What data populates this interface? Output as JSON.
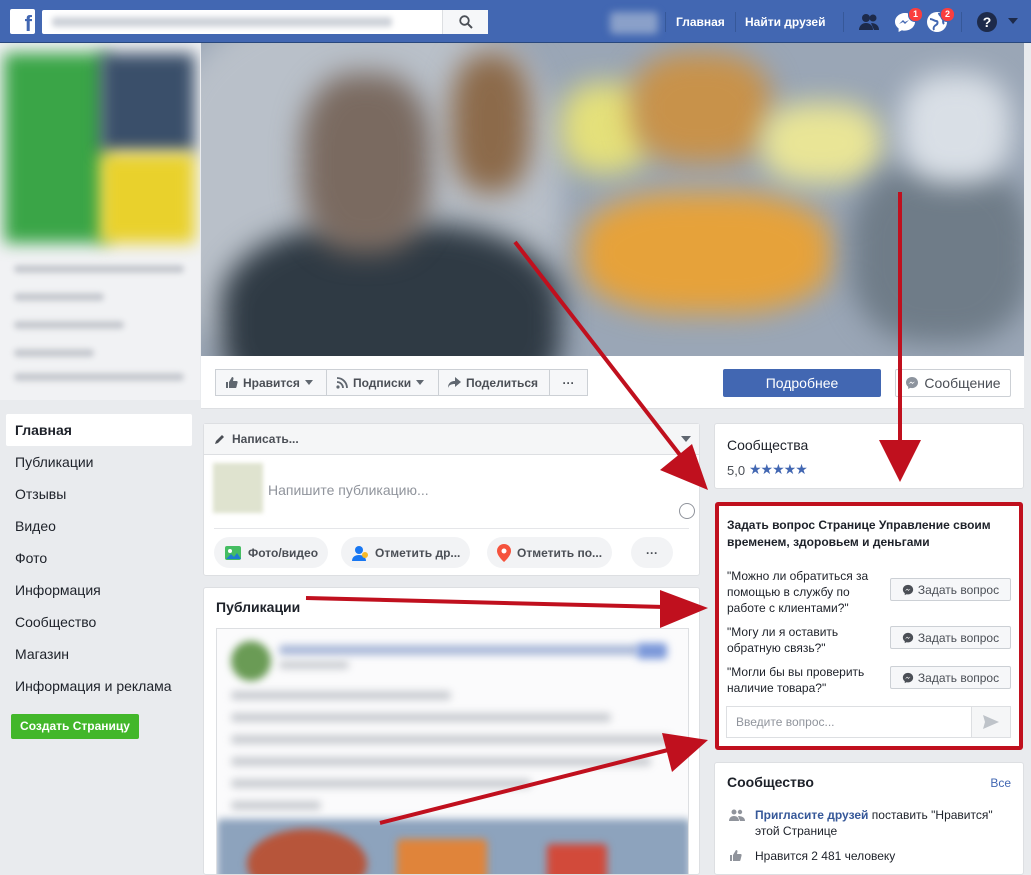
{
  "topbar": {
    "logo": "f",
    "search_placeholder": "",
    "nav_home": "Главная",
    "nav_find_friends": "Найти друзей",
    "friend_badge": "",
    "messages_badge": "1",
    "notifications_badge": "2"
  },
  "leftnav": {
    "items": [
      "Главная",
      "Публикации",
      "Отзывы",
      "Видео",
      "Фото",
      "Информация",
      "Сообщество",
      "Магазин",
      "Информация и реклама"
    ],
    "create_page": "Создать Страницу"
  },
  "actionbar": {
    "like": "Нравится",
    "follow": "Подписки",
    "share": "Поделиться",
    "more": "···",
    "learn_more": "Подробнее",
    "message": "Сообщение"
  },
  "composer": {
    "write_tab": "Написать...",
    "placeholder": "Напишите публикацию...",
    "photo_video": "Фото/видео",
    "tag_friends": "Отметить др...",
    "check_in": "Отметить по...",
    "more": "···"
  },
  "publications": {
    "title": "Публикации"
  },
  "rating": {
    "label": "Сообщества",
    "score": "5,0",
    "stars": "★★★★★"
  },
  "ask": {
    "title": "Задать вопрос Странице Управление своим временем, здоровьем и деньгами",
    "questions": [
      {
        "text": "\"Можно ли обратиться за помощью в службу по работе с клиентами?\"",
        "button": "Задать вопрос"
      },
      {
        "text": "\"Могу ли я оставить обратную связь?\"",
        "button": "Задать вопрос"
      },
      {
        "text": "\"Могли бы вы проверить наличие товара?\"",
        "button": "Задать вопрос"
      }
    ],
    "input_placeholder": "Введите вопрос..."
  },
  "community": {
    "title": "Сообщество",
    "see_all": "Все",
    "invite_link": "Пригласите друзей",
    "invite_rest": " поставить \"Нравится\" этой Странице",
    "likes": "Нравится 2 481 человеку"
  },
  "colors": {
    "brand_blue": "#4267b2",
    "highlight_red": "#c0101e",
    "create_green": "#42b72a"
  }
}
